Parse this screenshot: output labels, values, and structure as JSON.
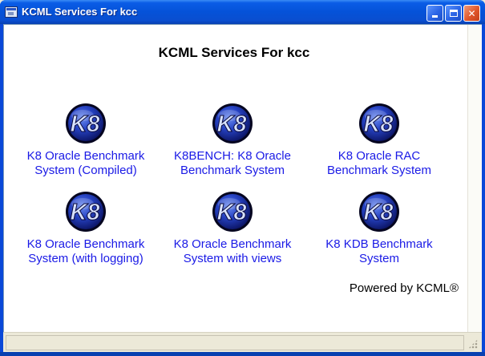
{
  "window": {
    "title": "KCML Services For kcc",
    "controls": {
      "minimize_icon": "minimize-icon",
      "maximize_icon": "maximize-icon",
      "close_label": "✕"
    }
  },
  "page": {
    "heading": "KCML Services For kcc",
    "powered_by": "Powered by KCML®"
  },
  "services": [
    {
      "line1": "K8 Oracle Benchmark",
      "line2": "System (Compiled)",
      "icon": "k8-logo-icon"
    },
    {
      "line1": "K8BENCH: K8 Oracle",
      "line2": "Benchmark System",
      "icon": "k8-logo-icon"
    },
    {
      "line1": "K8 Oracle RAC",
      "line2": "Benchmark System",
      "icon": "k8-logo-icon"
    },
    {
      "line1": "K8 Oracle Benchmark",
      "line2": "System (with logging)",
      "icon": "k8-logo-icon"
    },
    {
      "line1": "K8 Oracle Benchmark",
      "line2": "System with views",
      "icon": "k8-logo-icon"
    },
    {
      "line1": "K8 KDB Benchmark",
      "line2": "System",
      "icon": "k8-logo-icon"
    }
  ],
  "colors": {
    "link": "#1a1ae6",
    "titlebar": "#0552d8",
    "logo_ring": "#0a0a40",
    "logo_fill": "#2a4fd0"
  }
}
